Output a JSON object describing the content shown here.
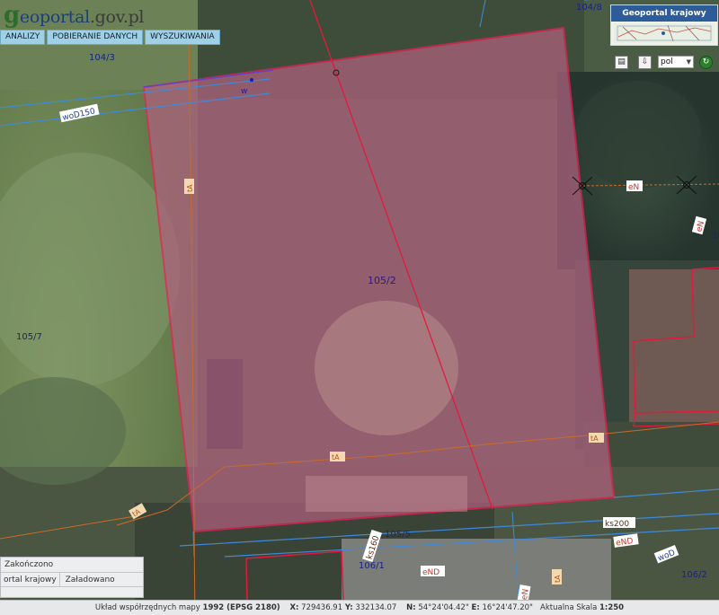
{
  "logo": {
    "g": "g",
    "rest": "eoportal",
    "dom": ".gov.pl"
  },
  "menu": [
    "ANALIZY",
    "POBIERANIE DANYCH",
    "WYSZUKIWANIA"
  ],
  "overview": {
    "title": "Geoportal krajowy"
  },
  "toolbar": {
    "language": "pol",
    "print_icon": "printer-icon",
    "export_icon": "export-icon",
    "refresh_icon": "refresh-icon"
  },
  "parcels": [
    "104/3",
    "104/8",
    "105/2",
    "105/7",
    "105/5",
    "106/1",
    "106/2",
    "10"
  ],
  "utility_labels": [
    "woD150",
    "w",
    "eN",
    "eN",
    "tA",
    "tA",
    "tA",
    "tA",
    "ks200",
    "eND",
    "eND",
    "ks160",
    "woD",
    "tA",
    "eN"
  ],
  "status_panel": {
    "row1": "Zakończono",
    "row2_left": "ortal krajowy",
    "row2_right": "Załadowano"
  },
  "statusbar": {
    "prefix": "Układ współrzędnych mapy",
    "system": "1992 (EPSG 2180)",
    "x_label": "X:",
    "x": "729436.91",
    "y_label": "Y:",
    "y": "332134.07",
    "n_label": "N:",
    "n": "54°24'04.42\"",
    "e_label": "E:",
    "e": "16°24'47.20\"",
    "scale_label": "Aktualna Skala",
    "scale": "1:250"
  }
}
